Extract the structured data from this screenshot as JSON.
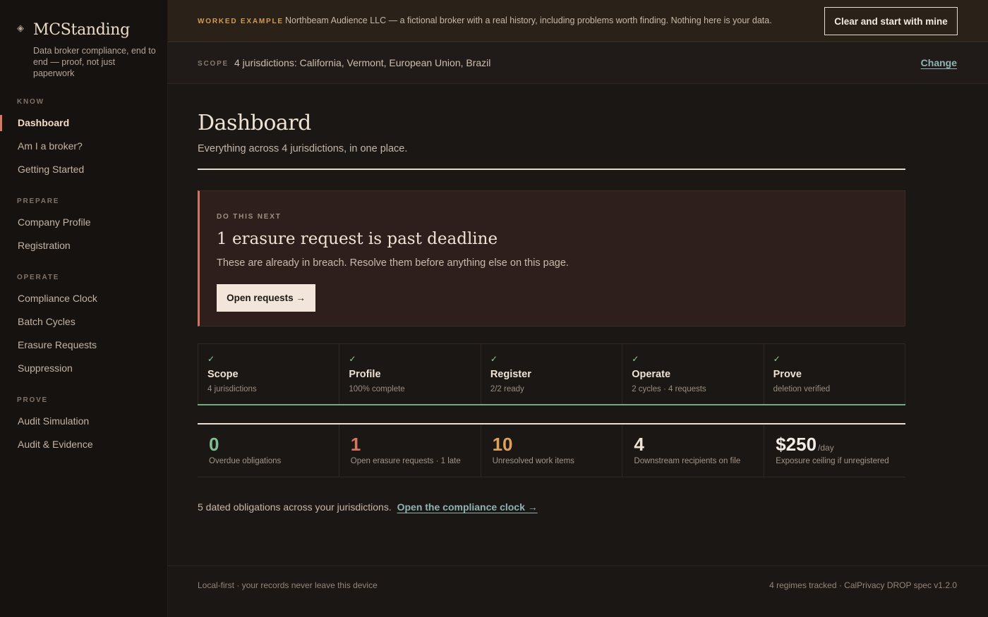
{
  "brand": {
    "name": "MCStanding",
    "tagline": "Data broker compliance, end to end — proof, not just paperwork",
    "icon": "diamond-icon"
  },
  "sidebar": {
    "sections": [
      {
        "heading": "KNOW",
        "items": [
          "Dashboard",
          "Am I a broker?",
          "Getting Started"
        ]
      },
      {
        "heading": "PREPARE",
        "items": [
          "Company Profile",
          "Registration"
        ]
      },
      {
        "heading": "OPERATE",
        "items": [
          "Compliance Clock",
          "Batch Cycles",
          "Erasure Requests",
          "Suppression"
        ]
      },
      {
        "heading": "PROVE",
        "items": [
          "Audit Simulation",
          "Audit & Evidence"
        ]
      }
    ],
    "active": "Dashboard"
  },
  "banner": {
    "tag": "WORKED EXAMPLE",
    "text": "Northbeam Audience LLC — a fictional broker with a real history, including problems worth finding. Nothing here is your data.",
    "button": "Clear and start with mine"
  },
  "scope": {
    "tag": "SCOPE",
    "text": "4 jurisdictions: California, Vermont, European Union, Brazil",
    "link": "Change"
  },
  "page": {
    "title": "Dashboard",
    "subtitle": "Everything across 4 jurisdictions, in one place."
  },
  "next": {
    "tag": "DO THIS NEXT",
    "title": "1 erasure request is past deadline",
    "text": "These are already in breach. Resolve them before anything else on this page.",
    "button": "Open requests →"
  },
  "steps": [
    {
      "check": "✓",
      "title": "Scope",
      "sub": "4 jurisdictions"
    },
    {
      "check": "✓",
      "title": "Profile",
      "sub": "100% complete"
    },
    {
      "check": "✓",
      "title": "Register",
      "sub": "2/2 ready"
    },
    {
      "check": "✓",
      "title": "Operate",
      "sub": "2 cycles · 4 requests"
    },
    {
      "check": "✓",
      "title": "Prove",
      "sub": "deletion verified"
    }
  ],
  "stats": [
    {
      "value": "0",
      "unit": "",
      "label": "Overdue obligations",
      "color": "#7fbf8f"
    },
    {
      "value": "1",
      "unit": "",
      "label": "Open erasure requests · 1 late",
      "color": "#d9755f"
    },
    {
      "value": "10",
      "unit": "",
      "label": "Unresolved work items",
      "color": "#dfa05a"
    },
    {
      "value": "4",
      "unit": "",
      "label": "Downstream recipients on file",
      "color": "#efe3d5"
    },
    {
      "value": "$250",
      "unit": "/day",
      "label": "Exposure ceiling if unregistered",
      "color": "#f3ece4"
    }
  ],
  "clock": {
    "text": "5 dated obligations across your jurisdictions.",
    "link": "Open the compliance clock →"
  },
  "footer": {
    "left": "Local-first · your records never leave this device",
    "right": "4 regimes tracked · CalPrivacy DROP spec v1.2.0"
  }
}
